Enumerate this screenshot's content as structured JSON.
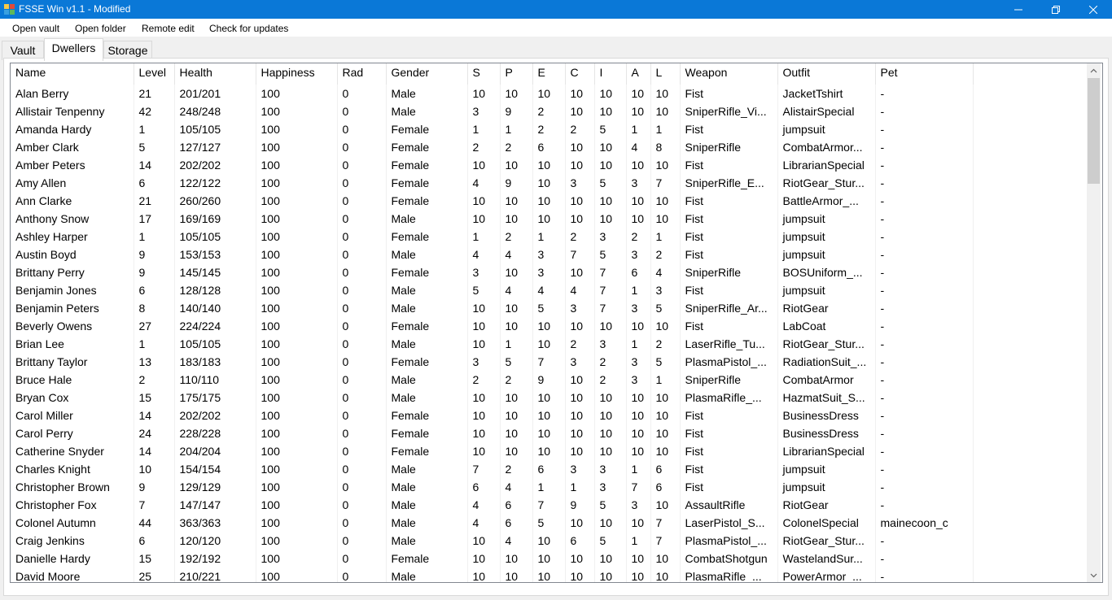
{
  "window": {
    "title": "FSSE Win v1.1 - Modified"
  },
  "menu": {
    "items": [
      "Open vault",
      "Open folder",
      "Remote edit",
      "Check for updates"
    ]
  },
  "tabs": [
    "Vault",
    "Dwellers",
    "Storage"
  ],
  "active_tab": "Dwellers",
  "table": {
    "columns": [
      "Name",
      "Level",
      "Health",
      "Happiness",
      "Rad",
      "Gender",
      "S",
      "P",
      "E",
      "C",
      "I",
      "A",
      "L",
      "Weapon",
      "Outfit",
      "Pet"
    ],
    "rows": [
      [
        "Alan Berry",
        "21",
        "201/201",
        "100",
        "0",
        "Male",
        "10",
        "10",
        "10",
        "10",
        "10",
        "10",
        "10",
        "Fist",
        "JacketTshirt",
        "-"
      ],
      [
        "Allistair Tenpenny",
        "42",
        "248/248",
        "100",
        "0",
        "Male",
        "3",
        "9",
        "2",
        "10",
        "10",
        "10",
        "10",
        "SniperRifle_Vi...",
        "AlistairSpecial",
        "-"
      ],
      [
        "Amanda Hardy",
        "1",
        "105/105",
        "100",
        "0",
        "Female",
        "1",
        "1",
        "2",
        "2",
        "5",
        "1",
        "1",
        "Fist",
        "jumpsuit",
        "-"
      ],
      [
        "Amber Clark",
        "5",
        "127/127",
        "100",
        "0",
        "Female",
        "2",
        "2",
        "6",
        "10",
        "10",
        "4",
        "8",
        "SniperRifle",
        "CombatArmor...",
        "-"
      ],
      [
        "Amber Peters",
        "14",
        "202/202",
        "100",
        "0",
        "Female",
        "10",
        "10",
        "10",
        "10",
        "10",
        "10",
        "10",
        "Fist",
        "LibrarianSpecial",
        "-"
      ],
      [
        "Amy Allen",
        "6",
        "122/122",
        "100",
        "0",
        "Female",
        "4",
        "9",
        "10",
        "3",
        "5",
        "3",
        "7",
        "SniperRifle_E...",
        "RiotGear_Stur...",
        "-"
      ],
      [
        "Ann Clarke",
        "21",
        "260/260",
        "100",
        "0",
        "Female",
        "10",
        "10",
        "10",
        "10",
        "10",
        "10",
        "10",
        "Fist",
        "BattleArmor_...",
        "-"
      ],
      [
        "Anthony Snow",
        "17",
        "169/169",
        "100",
        "0",
        "Male",
        "10",
        "10",
        "10",
        "10",
        "10",
        "10",
        "10",
        "Fist",
        "jumpsuit",
        "-"
      ],
      [
        "Ashley Harper",
        "1",
        "105/105",
        "100",
        "0",
        "Female",
        "1",
        "2",
        "1",
        "2",
        "3",
        "2",
        "1",
        "Fist",
        "jumpsuit",
        "-"
      ],
      [
        "Austin Boyd",
        "9",
        "153/153",
        "100",
        "0",
        "Male",
        "4",
        "4",
        "3",
        "7",
        "5",
        "3",
        "2",
        "Fist",
        "jumpsuit",
        "-"
      ],
      [
        "Brittany Perry",
        "9",
        "145/145",
        "100",
        "0",
        "Female",
        "3",
        "10",
        "3",
        "10",
        "7",
        "6",
        "4",
        "SniperRifle",
        "BOSUniform_...",
        "-"
      ],
      [
        "Benjamin Jones",
        "6",
        "128/128",
        "100",
        "0",
        "Male",
        "5",
        "4",
        "4",
        "4",
        "7",
        "1",
        "3",
        "Fist",
        "jumpsuit",
        "-"
      ],
      [
        "Benjamin Peters",
        "8",
        "140/140",
        "100",
        "0",
        "Male",
        "10",
        "10",
        "5",
        "3",
        "7",
        "3",
        "5",
        "SniperRifle_Ar...",
        "RiotGear",
        "-"
      ],
      [
        "Beverly Owens",
        "27",
        "224/224",
        "100",
        "0",
        "Female",
        "10",
        "10",
        "10",
        "10",
        "10",
        "10",
        "10",
        "Fist",
        "LabCoat",
        "-"
      ],
      [
        "Brian Lee",
        "1",
        "105/105",
        "100",
        "0",
        "Male",
        "10",
        "1",
        "10",
        "2",
        "3",
        "1",
        "2",
        "LaserRifle_Tu...",
        "RiotGear_Stur...",
        "-"
      ],
      [
        "Brittany Taylor",
        "13",
        "183/183",
        "100",
        "0",
        "Female",
        "3",
        "5",
        "7",
        "3",
        "2",
        "3",
        "5",
        "PlasmaPistol_...",
        "RadiationSuit_...",
        "-"
      ],
      [
        "Bruce Hale",
        "2",
        "110/110",
        "100",
        "0",
        "Male",
        "2",
        "2",
        "9",
        "10",
        "2",
        "3",
        "1",
        "SniperRifle",
        "CombatArmor",
        "-"
      ],
      [
        "Bryan Cox",
        "15",
        "175/175",
        "100",
        "0",
        "Male",
        "10",
        "10",
        "10",
        "10",
        "10",
        "10",
        "10",
        "PlasmaRifle_...",
        "HazmatSuit_S...",
        "-"
      ],
      [
        "Carol Miller",
        "14",
        "202/202",
        "100",
        "0",
        "Female",
        "10",
        "10",
        "10",
        "10",
        "10",
        "10",
        "10",
        "Fist",
        "BusinessDress",
        "-"
      ],
      [
        "Carol Perry",
        "24",
        "228/228",
        "100",
        "0",
        "Female",
        "10",
        "10",
        "10",
        "10",
        "10",
        "10",
        "10",
        "Fist",
        "BusinessDress",
        "-"
      ],
      [
        "Catherine Snyder",
        "14",
        "204/204",
        "100",
        "0",
        "Female",
        "10",
        "10",
        "10",
        "10",
        "10",
        "10",
        "10",
        "Fist",
        "LibrarianSpecial",
        "-"
      ],
      [
        "Charles Knight",
        "10",
        "154/154",
        "100",
        "0",
        "Male",
        "7",
        "2",
        "6",
        "3",
        "3",
        "1",
        "6",
        "Fist",
        "jumpsuit",
        "-"
      ],
      [
        "Christopher Brown",
        "9",
        "129/129",
        "100",
        "0",
        "Male",
        "6",
        "4",
        "1",
        "1",
        "3",
        "7",
        "6",
        "Fist",
        "jumpsuit",
        "-"
      ],
      [
        "Christopher Fox",
        "7",
        "147/147",
        "100",
        "0",
        "Male",
        "4",
        "6",
        "7",
        "9",
        "5",
        "3",
        "10",
        "AssaultRifle",
        "RiotGear",
        "-"
      ],
      [
        "Colonel Autumn",
        "44",
        "363/363",
        "100",
        "0",
        "Male",
        "4",
        "6",
        "5",
        "10",
        "10",
        "10",
        "7",
        "LaserPistol_S...",
        "ColonelSpecial",
        "mainecoon_c"
      ],
      [
        "Craig Jenkins",
        "6",
        "120/120",
        "100",
        "0",
        "Male",
        "10",
        "4",
        "10",
        "6",
        "5",
        "1",
        "7",
        "PlasmaPistol_...",
        "RiotGear_Stur...",
        "-"
      ],
      [
        "Danielle Hardy",
        "15",
        "192/192",
        "100",
        "0",
        "Female",
        "10",
        "10",
        "10",
        "10",
        "10",
        "10",
        "10",
        "CombatShotgun",
        "WastelandSur...",
        "-"
      ],
      [
        "David Moore",
        "25",
        "210/221",
        "100",
        "0",
        "Male",
        "10",
        "10",
        "10",
        "10",
        "10",
        "10",
        "10",
        "PlasmaRifle_...",
        "PowerArmor_...",
        "-"
      ]
    ]
  }
}
